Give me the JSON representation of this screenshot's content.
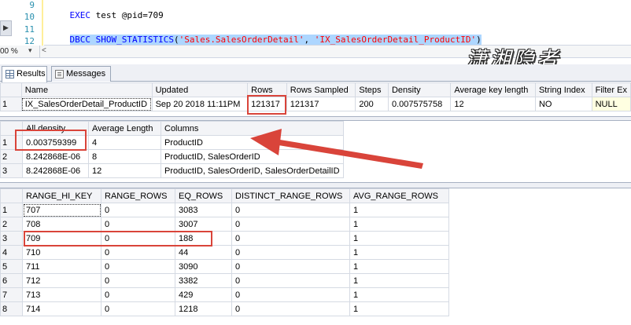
{
  "editor": {
    "line_numbers": [
      "9",
      "10",
      "11",
      "12"
    ],
    "line9": {
      "kw": "EXEC",
      "rest": " test @pid=709"
    },
    "line11": {
      "kw": "DBCC SHOW_STATISTICS",
      "open": "(",
      "arg1": "'Sales.SalesOrderDetail'",
      "comma": ", ",
      "arg2": "'IX_SalesOrderDetail_ProductID'",
      "close": ")"
    }
  },
  "zoom": {
    "value": "00 %",
    "caret": "▾",
    "scroll_left": "<"
  },
  "tabs": {
    "results": "Results",
    "messages": "Messages"
  },
  "watermark": "潇湘隐者",
  "header_grid": {
    "columns": [
      "Name",
      "Updated",
      "Rows",
      "Rows Sampled",
      "Steps",
      "Density",
      "Average key length",
      "String Index",
      "Filter Ex"
    ],
    "rows": [
      {
        "n": "1",
        "cells": [
          "IX_SalesOrderDetail_ProductID",
          "Sep 20 2018 11:11PM",
          "121317",
          "121317",
          "200",
          "0.007575758",
          "12",
          "NO",
          "NULL"
        ]
      }
    ]
  },
  "density_grid": {
    "columns": [
      "All density",
      "Average Length",
      "Columns"
    ],
    "rows": [
      {
        "n": "1",
        "cells": [
          "0.003759399",
          "4",
          "ProductID"
        ]
      },
      {
        "n": "2",
        "cells": [
          "8.242868E-06",
          "8",
          "ProductID, SalesOrderID"
        ]
      },
      {
        "n": "3",
        "cells": [
          "8.242868E-06",
          "12",
          "ProductID, SalesOrderID, SalesOrderDetailID"
        ]
      }
    ]
  },
  "histogram_grid": {
    "columns": [
      "RANGE_HI_KEY",
      "RANGE_ROWS",
      "EQ_ROWS",
      "DISTINCT_RANGE_ROWS",
      "AVG_RANGE_ROWS"
    ],
    "rows": [
      {
        "n": "1",
        "cells": [
          "707",
          "0",
          "3083",
          "0",
          "1"
        ]
      },
      {
        "n": "2",
        "cells": [
          "708",
          "0",
          "3007",
          "0",
          "1"
        ]
      },
      {
        "n": "3",
        "cells": [
          "709",
          "0",
          "188",
          "0",
          "1"
        ]
      },
      {
        "n": "4",
        "cells": [
          "710",
          "0",
          "44",
          "0",
          "1"
        ]
      },
      {
        "n": "5",
        "cells": [
          "711",
          "0",
          "3090",
          "0",
          "1"
        ]
      },
      {
        "n": "6",
        "cells": [
          "712",
          "0",
          "3382",
          "0",
          "1"
        ]
      },
      {
        "n": "7",
        "cells": [
          "713",
          "0",
          "429",
          "0",
          "1"
        ]
      },
      {
        "n": "8",
        "cells": [
          "714",
          "0",
          "1218",
          "0",
          "1"
        ]
      }
    ]
  },
  "colors": {
    "annotation_red": "#d9443a",
    "selection": "#add6ff",
    "keyword": "#0000ff",
    "string": "#ff0000"
  }
}
